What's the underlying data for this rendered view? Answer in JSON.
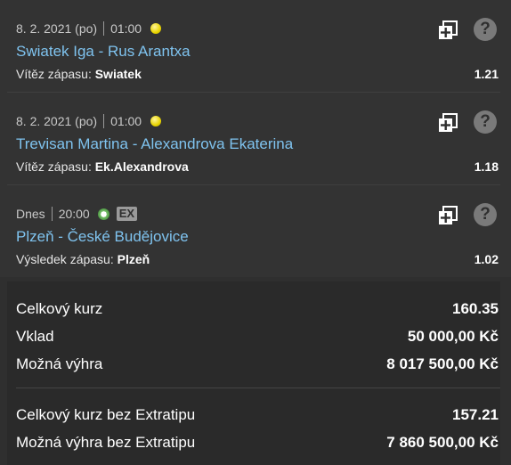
{
  "bets": [
    {
      "date": "8. 2. 2021 (po)",
      "time": "01:00",
      "sport_icon": "tennis-ball-icon",
      "ex": "",
      "match": "Swiatek Iga - Rus Arantxa",
      "market": "Vítěz zápasu:",
      "pick": "Swiatek",
      "odd": "1.21"
    },
    {
      "date": "8. 2. 2021 (po)",
      "time": "01:00",
      "sport_icon": "tennis-ball-icon",
      "ex": "",
      "match": "Trevisan Martina - Alexandrova Ekaterina",
      "market": "Vítěz zápasu:",
      "pick": "Ek.Alexandrova",
      "odd": "1.18"
    },
    {
      "date": "Dnes",
      "time": "20:00",
      "sport_icon": "soccer-ball-icon",
      "ex": "EX",
      "match": "Plzeň - České Budějovice",
      "market": "Výsledek zápasu:",
      "pick": "Plzeň",
      "odd": "1.02"
    }
  ],
  "summary": {
    "total_odds_label": "Celkový kurz",
    "total_odds_value": "160.35",
    "stake_label": "Vklad",
    "stake_value": "50 000,00 Kč",
    "win_label": "Možná výhra",
    "win_value": "8 017 500,00 Kč",
    "total_odds_no_extra_label": "Celkový kurz bez Extratipu",
    "total_odds_no_extra_value": "157.21",
    "win_no_extra_label": "Možná výhra bez Extratipu",
    "win_no_extra_value": "7 860 500,00 Kč"
  },
  "colors": {
    "link": "#7fc3ef",
    "background": "#2f2f2f"
  }
}
